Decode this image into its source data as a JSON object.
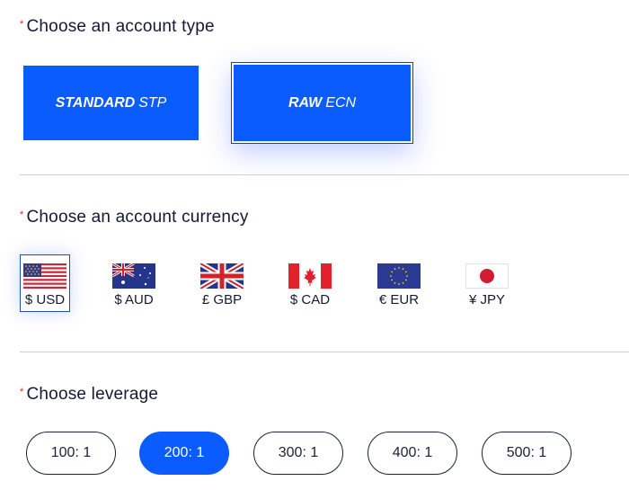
{
  "sections": {
    "account_type": {
      "required_mark": "*",
      "label": "Choose an account type",
      "options": [
        {
          "bold": "STANDARD",
          "light": "STP",
          "selected": false
        },
        {
          "bold": "RAW",
          "light": "ECN",
          "selected": true
        }
      ]
    },
    "currency": {
      "required_mark": "*",
      "label": "Choose an account currency",
      "options": [
        {
          "label": "$ USD",
          "flag": "us-flag-icon",
          "selected": true
        },
        {
          "label": "$ AUD",
          "flag": "au-flag-icon",
          "selected": false
        },
        {
          "label": "£ GBP",
          "flag": "gb-flag-icon",
          "selected": false
        },
        {
          "label": "$ CAD",
          "flag": "ca-flag-icon",
          "selected": false
        },
        {
          "label": "€ EUR",
          "flag": "eu-flag-icon",
          "selected": false
        },
        {
          "label": "¥ JPY",
          "flag": "jp-flag-icon",
          "selected": false
        }
      ]
    },
    "leverage": {
      "required_mark": "*",
      "label": "Choose leverage",
      "options": [
        {
          "label": "100: 1",
          "selected": false
        },
        {
          "label": "200: 1",
          "selected": true
        },
        {
          "label": "300: 1",
          "selected": false
        },
        {
          "label": "400: 1",
          "selected": false
        },
        {
          "label": "500: 1",
          "selected": false
        }
      ]
    }
  },
  "colors": {
    "accent": "#0a5cff",
    "required": "#e02020",
    "text": "#141a33"
  }
}
